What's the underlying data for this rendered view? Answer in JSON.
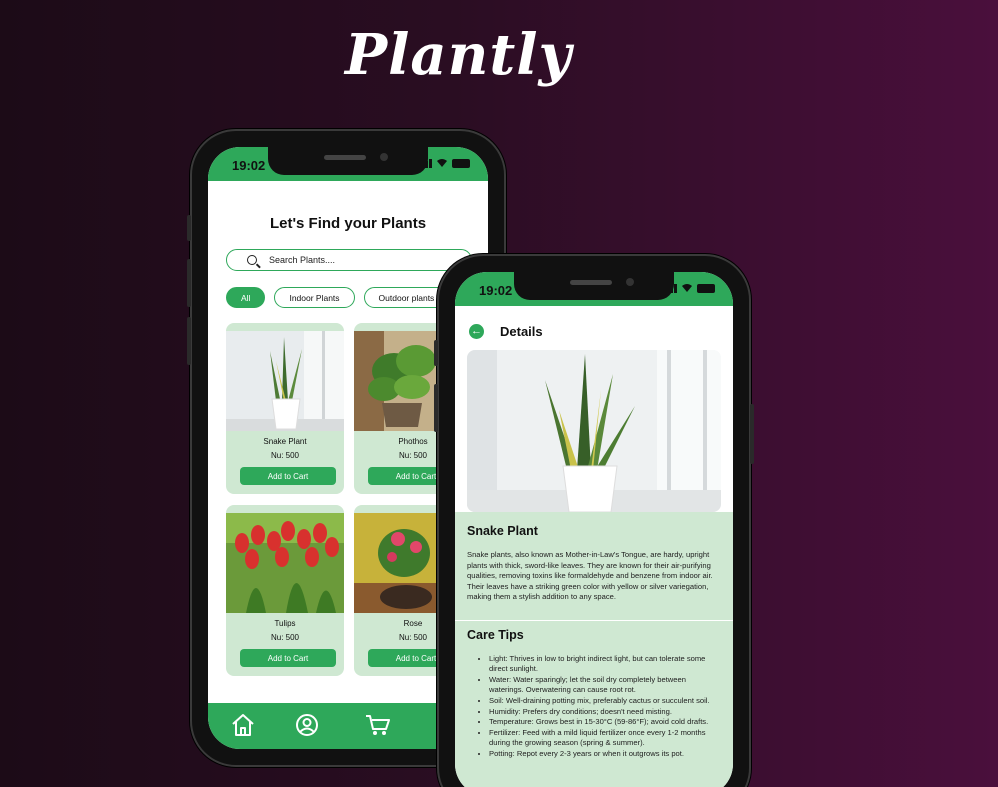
{
  "brand": {
    "logo": "Plantly"
  },
  "colors": {
    "accent": "#2ea85a",
    "card_bg": "#cfe8d2"
  },
  "home_screen": {
    "status": {
      "time": "19:02"
    },
    "title": "Let's Find your Plants",
    "search": {
      "placeholder": "Search Plants...."
    },
    "filters": [
      {
        "label": "All",
        "active": true
      },
      {
        "label": "Indoor Plants",
        "active": false
      },
      {
        "label": "Outdoor plants",
        "active": false
      }
    ],
    "products": [
      {
        "name": "Snake Plant",
        "price": "Nu: 500",
        "button": "Add to Cart"
      },
      {
        "name": "Phothos",
        "price": "Nu: 500",
        "button": "Add to Cart"
      },
      {
        "name": "Tulips",
        "price": "Nu: 500",
        "button": "Add to Cart"
      },
      {
        "name": "Rose",
        "price": "Nu: 500",
        "button": "Add to Cart"
      }
    ],
    "nav": [
      {
        "icon": "home-icon"
      },
      {
        "icon": "profile-icon"
      },
      {
        "icon": "cart-icon"
      }
    ]
  },
  "detail_screen": {
    "status": {
      "time": "19:02"
    },
    "title": "Details",
    "plant_name": "Snake Plant",
    "description": "Snake plants, also known as Mother-in-Law's Tongue, are hardy, upright plants with thick, sword-like leaves. They are known for their air-purifying qualities, removing toxins like formaldehyde and benzene from indoor air. Their leaves have a striking green color with yellow or silver variegation, making them a stylish addition to any space.",
    "care_title": "Care Tips",
    "care_tips": [
      "Light: Thrives in low to bright indirect light, but can tolerate some direct sunlight.",
      "Water: Water sparingly; let the soil dry completely between waterings. Overwatering can cause root rot.",
      "Soil: Well-draining potting mix, preferably cactus or succulent soil.",
      "Humidity: Prefers dry conditions; doesn't need misting.",
      "Temperature: Grows best in 15-30°C (59-86°F); avoid cold drafts.",
      "Fertilizer: Feed with a mild liquid fertilizer once every 1-2 months during the growing season (spring & summer).",
      "Potting: Repot every 2-3 years or when it outgrows its pot."
    ]
  }
}
